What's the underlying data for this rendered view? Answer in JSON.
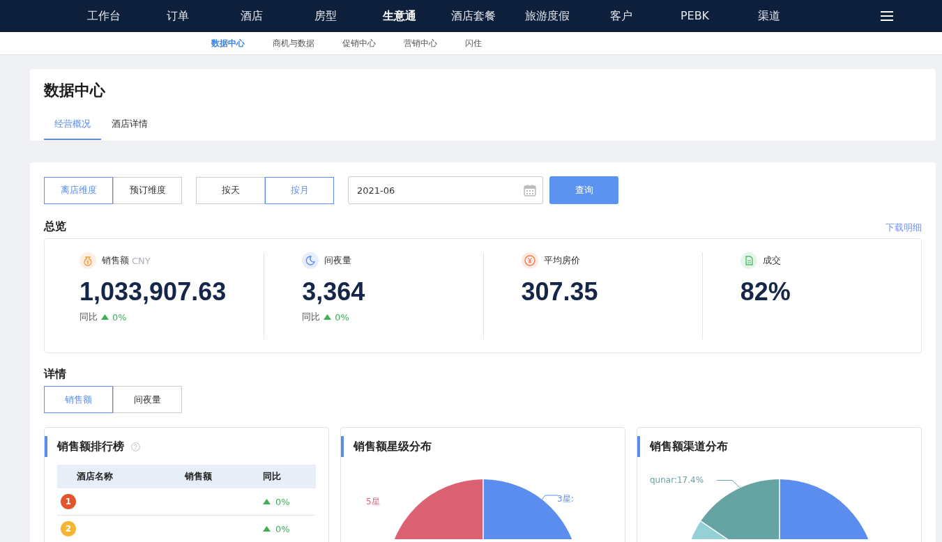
{
  "top_nav": [
    {
      "label": "工作台",
      "selected": false
    },
    {
      "label": "订单",
      "selected": false
    },
    {
      "label": "酒店",
      "selected": false
    },
    {
      "label": "房型",
      "selected": false
    },
    {
      "label": "生意通",
      "selected": true
    },
    {
      "label": "酒店套餐",
      "selected": false
    },
    {
      "label": "旅游度假",
      "selected": false
    },
    {
      "label": "客户",
      "selected": false
    },
    {
      "label": "PEBK",
      "selected": false
    },
    {
      "label": "渠道",
      "selected": false
    }
  ],
  "sub_nav": [
    {
      "label": "数据中心",
      "selected": true
    },
    {
      "label": "商机与数据",
      "selected": false
    },
    {
      "label": "促销中心",
      "selected": false
    },
    {
      "label": "营销中心",
      "selected": false
    },
    {
      "label": "闪住",
      "selected": false
    }
  ],
  "page_title": "数据中心",
  "page_tabs": [
    {
      "label": "经营概况",
      "selected": true
    },
    {
      "label": "酒店详情",
      "selected": false
    }
  ],
  "dimension_toggle": [
    {
      "label": "离店维度",
      "selected": true
    },
    {
      "label": "预订维度",
      "selected": false
    }
  ],
  "period_toggle": [
    {
      "label": "按天",
      "selected": false
    },
    {
      "label": "按月",
      "selected": true
    }
  ],
  "date_field": {
    "value": "2021-06"
  },
  "query_button": "查询",
  "overview": {
    "title": "总览",
    "download_link": "下载明细",
    "metrics": [
      {
        "kind": "money",
        "label": "销售额",
        "unit": "CNY",
        "value": "1,033,907.63",
        "compare_label": "同比",
        "compare_value": "0%"
      },
      {
        "kind": "night",
        "label": "间夜量",
        "value": "3,364",
        "compare_label": "同比",
        "compare_value": "0%"
      },
      {
        "kind": "price",
        "label": "平均房价",
        "value": "307.35"
      },
      {
        "kind": "doc",
        "label": "成交",
        "value": "82%"
      }
    ]
  },
  "details": {
    "title": "详情",
    "toggle": [
      {
        "label": "销售额",
        "selected": true
      },
      {
        "label": "间夜量",
        "selected": false
      }
    ]
  },
  "ranking": {
    "title": "销售额排行榜",
    "columns": [
      "酒店名称",
      "销售额",
      "同比"
    ],
    "rows": [
      {
        "rank": "1",
        "change": "0%"
      },
      {
        "rank": "2",
        "change": "0%"
      }
    ]
  },
  "star_chart": {
    "title": "销售额星级分布",
    "labels": [
      "5星",
      "3星:"
    ]
  },
  "channel_chart": {
    "title": "销售额渠道分布",
    "labels": [
      "qunar:17.4%"
    ]
  }
}
